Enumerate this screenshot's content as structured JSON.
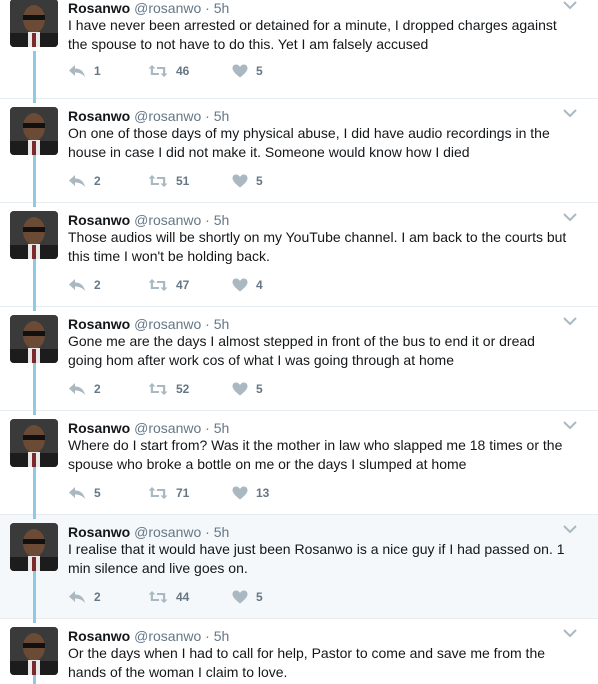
{
  "tweets": [
    {
      "name": "Rosanwo",
      "handle": "@rosanwo",
      "dot": "·",
      "time": "5h",
      "text": "I have never been arrested or detained for a minute, I dropped charges against the spouse to not have to do this. Yet I am falsely accused",
      "replies": "1",
      "retweets": "46",
      "likes": "5",
      "highlighted": false
    },
    {
      "name": "Rosanwo",
      "handle": "@rosanwo",
      "dot": "·",
      "time": "5h",
      "text": "On one of those days of my physical abuse, I did have audio recordings in the house in case I did not make it. Someone would know how I died",
      "replies": "2",
      "retweets": "51",
      "likes": "5",
      "highlighted": false
    },
    {
      "name": "Rosanwo",
      "handle": "@rosanwo",
      "dot": "·",
      "time": "5h",
      "text": "Those audios will be shortly on my YouTube channel. I am back to the courts but this time I won't be holding back.",
      "replies": "2",
      "retweets": "47",
      "likes": "4",
      "highlighted": false
    },
    {
      "name": "Rosanwo",
      "handle": "@rosanwo",
      "dot": "·",
      "time": "5h",
      "text": "Gone me are the days I almost stepped in front of the bus to end it or dread going hom after work cos of what I was going through at home",
      "replies": "2",
      "retweets": "52",
      "likes": "5",
      "highlighted": false
    },
    {
      "name": "Rosanwo",
      "handle": "@rosanwo",
      "dot": "·",
      "time": "5h",
      "text": "Where do I start from? Was it the mother in law who slapped me 18 times or the spouse who broke a bottle on me or the days I slumped at home",
      "replies": "5",
      "retweets": "71",
      "likes": "13",
      "highlighted": false
    },
    {
      "name": "Rosanwo",
      "handle": "@rosanwo",
      "dot": "·",
      "time": "5h",
      "text": "I realise that it would have just been Rosanwo is a nice guy if I had passed on. 1 min silence and live goes on.",
      "replies": "2",
      "retweets": "44",
      "likes": "5",
      "highlighted": true
    },
    {
      "name": "Rosanwo",
      "handle": "@rosanwo",
      "dot": "·",
      "time": "5h",
      "text": "Or the days when I had to call for help, Pastor to come and save me from the hands of the woman I claim to love.",
      "highlighted": false
    }
  ],
  "icons": {
    "reply": "reply-icon",
    "retweet": "retweet-icon",
    "like": "heart-icon",
    "caret": "chevron-down-icon",
    "avatar": "avatar"
  },
  "colors": {
    "text": "#14171a",
    "secondary": "#657786",
    "action_icon": "#aab8c2",
    "thread_line": "#8ecae6",
    "highlight_bg": "#f5f8fa",
    "divider": "#e6ecf0"
  }
}
